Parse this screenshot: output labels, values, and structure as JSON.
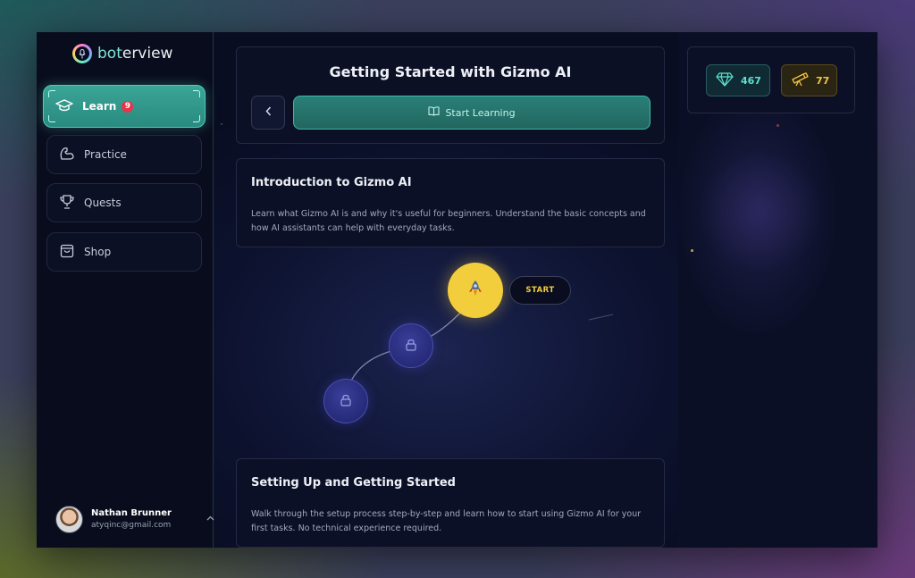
{
  "app": {
    "logo_text_prefix": "bot",
    "logo_text_suffix": "erview",
    "logo_icon": "microphone-icon"
  },
  "sidebar": {
    "items": [
      {
        "label": "Learn",
        "icon": "graduation-cap-icon",
        "badge": "9",
        "active": true
      },
      {
        "label": "Practice",
        "icon": "flexed-arm-icon"
      },
      {
        "label": "Quests",
        "icon": "trophy-icon"
      },
      {
        "label": "Shop",
        "icon": "shopping-bag-icon"
      }
    ]
  },
  "user": {
    "name": "Nathan Brunner",
    "email": "atyqinc@gmail.com"
  },
  "header": {
    "title": "Getting Started with Gizmo AI",
    "back_icon": "chevron-left-icon",
    "start_label": "Start Learning",
    "start_icon": "open-book-icon"
  },
  "stats": {
    "gems": "467",
    "gems_icon": "diamond-icon",
    "telescope": "77",
    "telescope_icon": "telescope-icon"
  },
  "lessons": [
    {
      "title": "Introduction to Gizmo AI",
      "description": "Learn what Gizmo AI is and why it's useful for beginners. Understand the basic concepts and how AI assistants can help with everyday tasks."
    },
    {
      "title": "Setting Up and Getting Started",
      "description": "Walk through the setup process step-by-step and learn how to start using Gizmo AI for your first tasks. No technical experience required."
    }
  ],
  "path": {
    "start_label": "START",
    "active_icon": "rocket-icon",
    "locked_icon": "lock-icon"
  },
  "colors": {
    "accent_teal": "#3aa596",
    "accent_yellow": "#f2cd3c",
    "badge_red": "#e8344b",
    "background": "#0d1330"
  }
}
